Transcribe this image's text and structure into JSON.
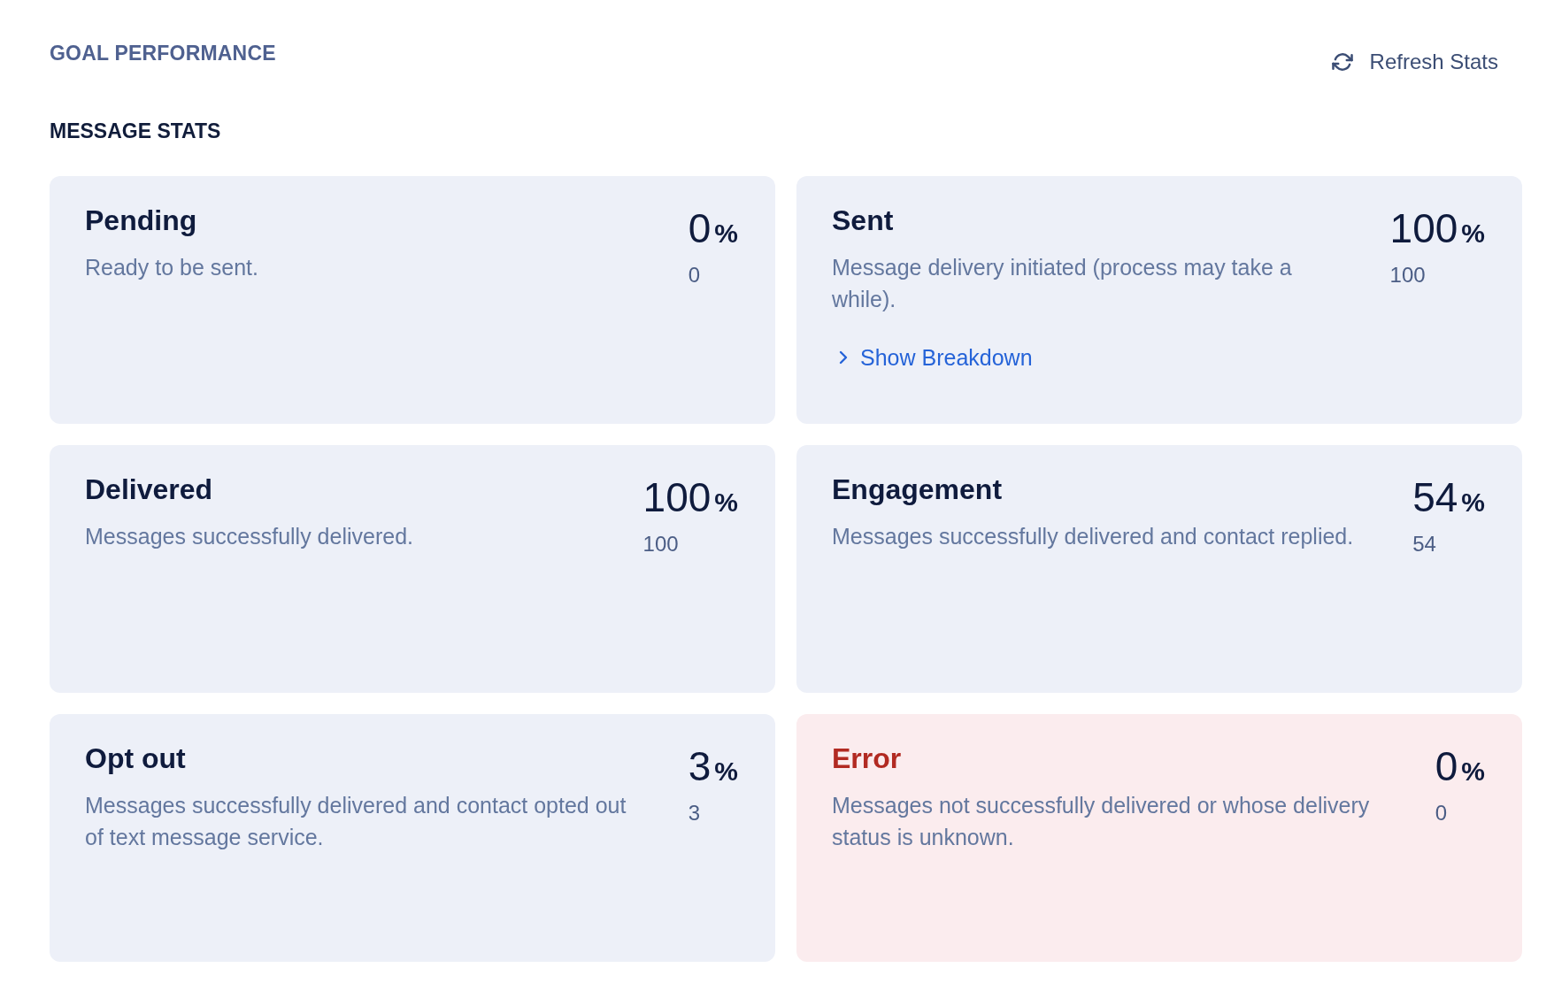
{
  "header": {
    "title": "GOAL PERFORMANCE",
    "refresh_button": {
      "label": "Refresh Stats"
    }
  },
  "message_stats": {
    "title": "MESSAGE STATS",
    "cards": [
      {
        "kind": "neutral",
        "title": "Pending",
        "description": "Ready to be sent.",
        "percent": "0",
        "unit": "%",
        "count": "0"
      },
      {
        "kind": "neutral",
        "title": "Sent",
        "description": "Message delivery initiated (process may take a while).",
        "percent": "100",
        "unit": "%",
        "count": "100",
        "breakdown": {
          "label": "Show Breakdown",
          "expanded": false
        }
      },
      {
        "kind": "neutral",
        "title": "Delivered",
        "description": "Messages successfully delivered.",
        "percent": "100",
        "unit": "%",
        "count": "100"
      },
      {
        "kind": "neutral",
        "title": "Engagement",
        "description": "Messages successfully delivered and contact replied.",
        "percent": "54",
        "unit": "%",
        "count": "54"
      },
      {
        "kind": "neutral",
        "title": "Opt out",
        "description": "Messages successfully delivered and contact opted out of text message service.",
        "percent": "3",
        "unit": "%",
        "count": "3"
      },
      {
        "kind": "error",
        "title": "Error",
        "description": "Messages not successfully delivered or whose delivery status is unknown.",
        "percent": "0",
        "unit": "%",
        "count": "0"
      }
    ]
  }
}
